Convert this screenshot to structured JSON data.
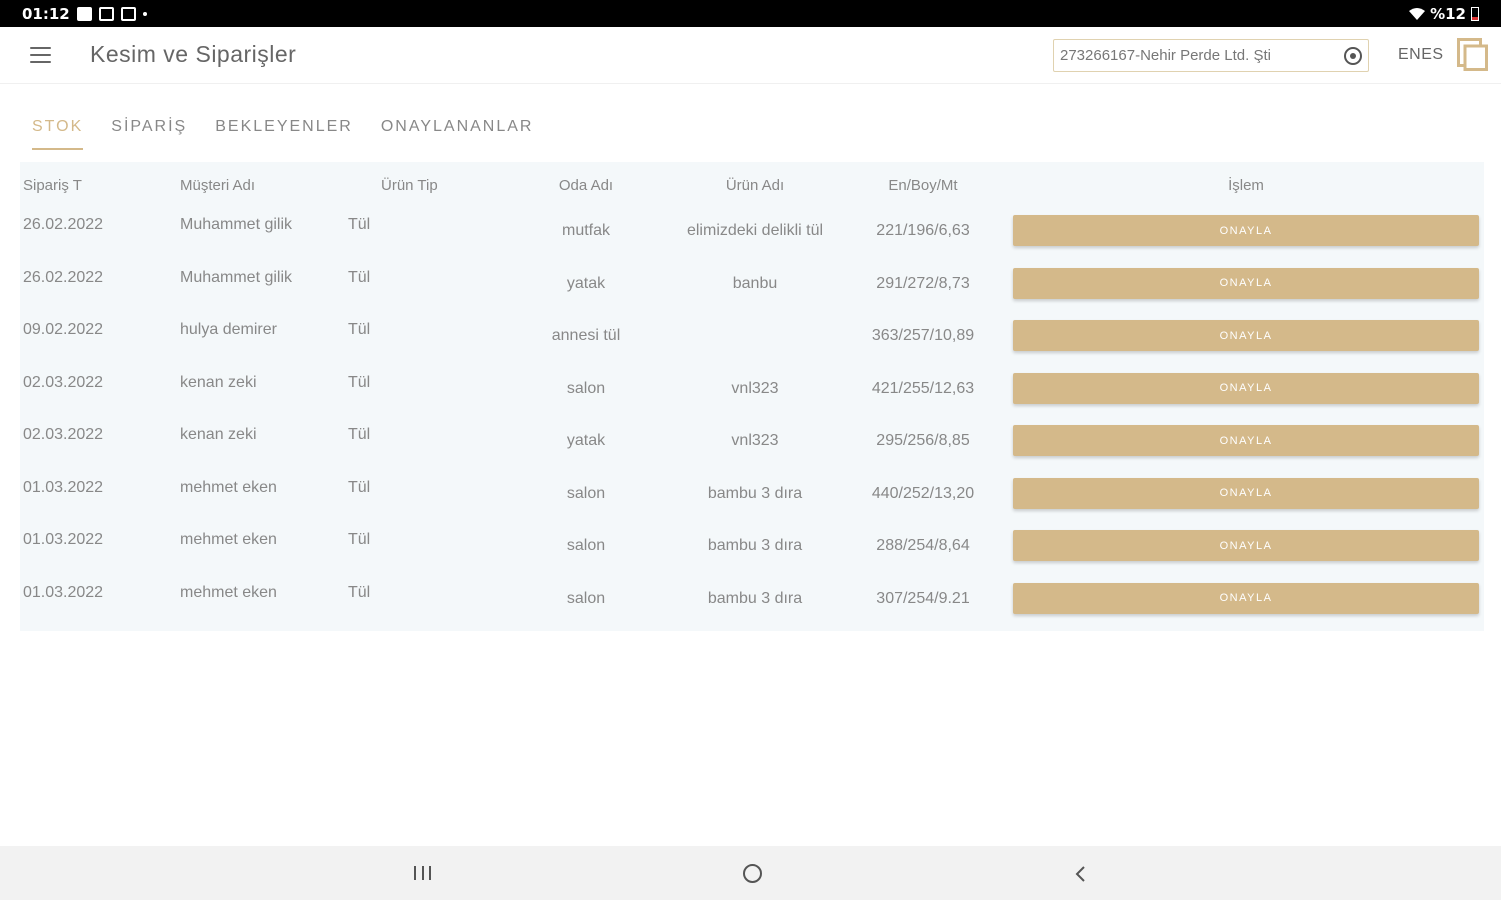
{
  "status_bar": {
    "time": "01:12",
    "battery": "%12"
  },
  "app_bar": {
    "title": "Kesim ve Siparişler",
    "search_value": "273266167-Nehir Perde Ltd. Şti",
    "user": "ENES"
  },
  "tabs": [
    {
      "label": "STOK",
      "active": true
    },
    {
      "label": "SİPARİŞ",
      "active": false
    },
    {
      "label": "BEKLEYENLER",
      "active": false
    },
    {
      "label": "ONAYLANANLAR",
      "active": false
    }
  ],
  "table": {
    "headers": [
      "Sipariş T",
      "Müşteri Adı",
      "Ürün Tip",
      "Oda Adı",
      "Ürün Adı",
      "En/Boy/Mt",
      "İşlem"
    ],
    "rows": [
      {
        "date": "26.02.2022",
        "customer": "Muhammet gilik",
        "type": "Tül",
        "room": "mutfak",
        "product": "elimizdeki delikli tül",
        "dims": "221/196/6,63",
        "action": "ONAYLA"
      },
      {
        "date": "26.02.2022",
        "customer": "Muhammet gilik",
        "type": "Tül",
        "room": "yatak",
        "product": "banbu",
        "dims": "291/272/8,73",
        "action": "ONAYLA"
      },
      {
        "date": "09.02.2022",
        "customer": "hulya demirer",
        "type": "Tül",
        "room": "annesi tül",
        "product": "",
        "dims": "363/257/10,89",
        "action": "ONAYLA"
      },
      {
        "date": "02.03.2022",
        "customer": "kenan zeki",
        "type": "Tül",
        "room": "salon",
        "product": "vnl323",
        "dims": "421/255/12,63",
        "action": "ONAYLA"
      },
      {
        "date": "02.03.2022",
        "customer": "kenan zeki",
        "type": "Tül",
        "room": "yatak",
        "product": "vnl323",
        "dims": "295/256/8,85",
        "action": "ONAYLA"
      },
      {
        "date": "01.03.2022",
        "customer": "mehmet eken",
        "type": "Tül",
        "room": "salon",
        "product": "bambu 3 dıra",
        "dims": "440/252/13,20",
        "action": "ONAYLA"
      },
      {
        "date": "01.03.2022",
        "customer": "mehmet eken",
        "type": "Tül",
        "room": "salon",
        "product": "bambu 3 dıra",
        "dims": "288/254/8,64",
        "action": "ONAYLA"
      },
      {
        "date": "01.03.2022",
        "customer": "mehmet eken",
        "type": "Tül",
        "room": "salon",
        "product": "bambu 3 dıra",
        "dims": "307/254/9.21",
        "action": "ONAYLA"
      }
    ]
  },
  "colors": {
    "accent": "#d4b98a",
    "table_bg": "#f4f8fa",
    "text": "#888888"
  }
}
